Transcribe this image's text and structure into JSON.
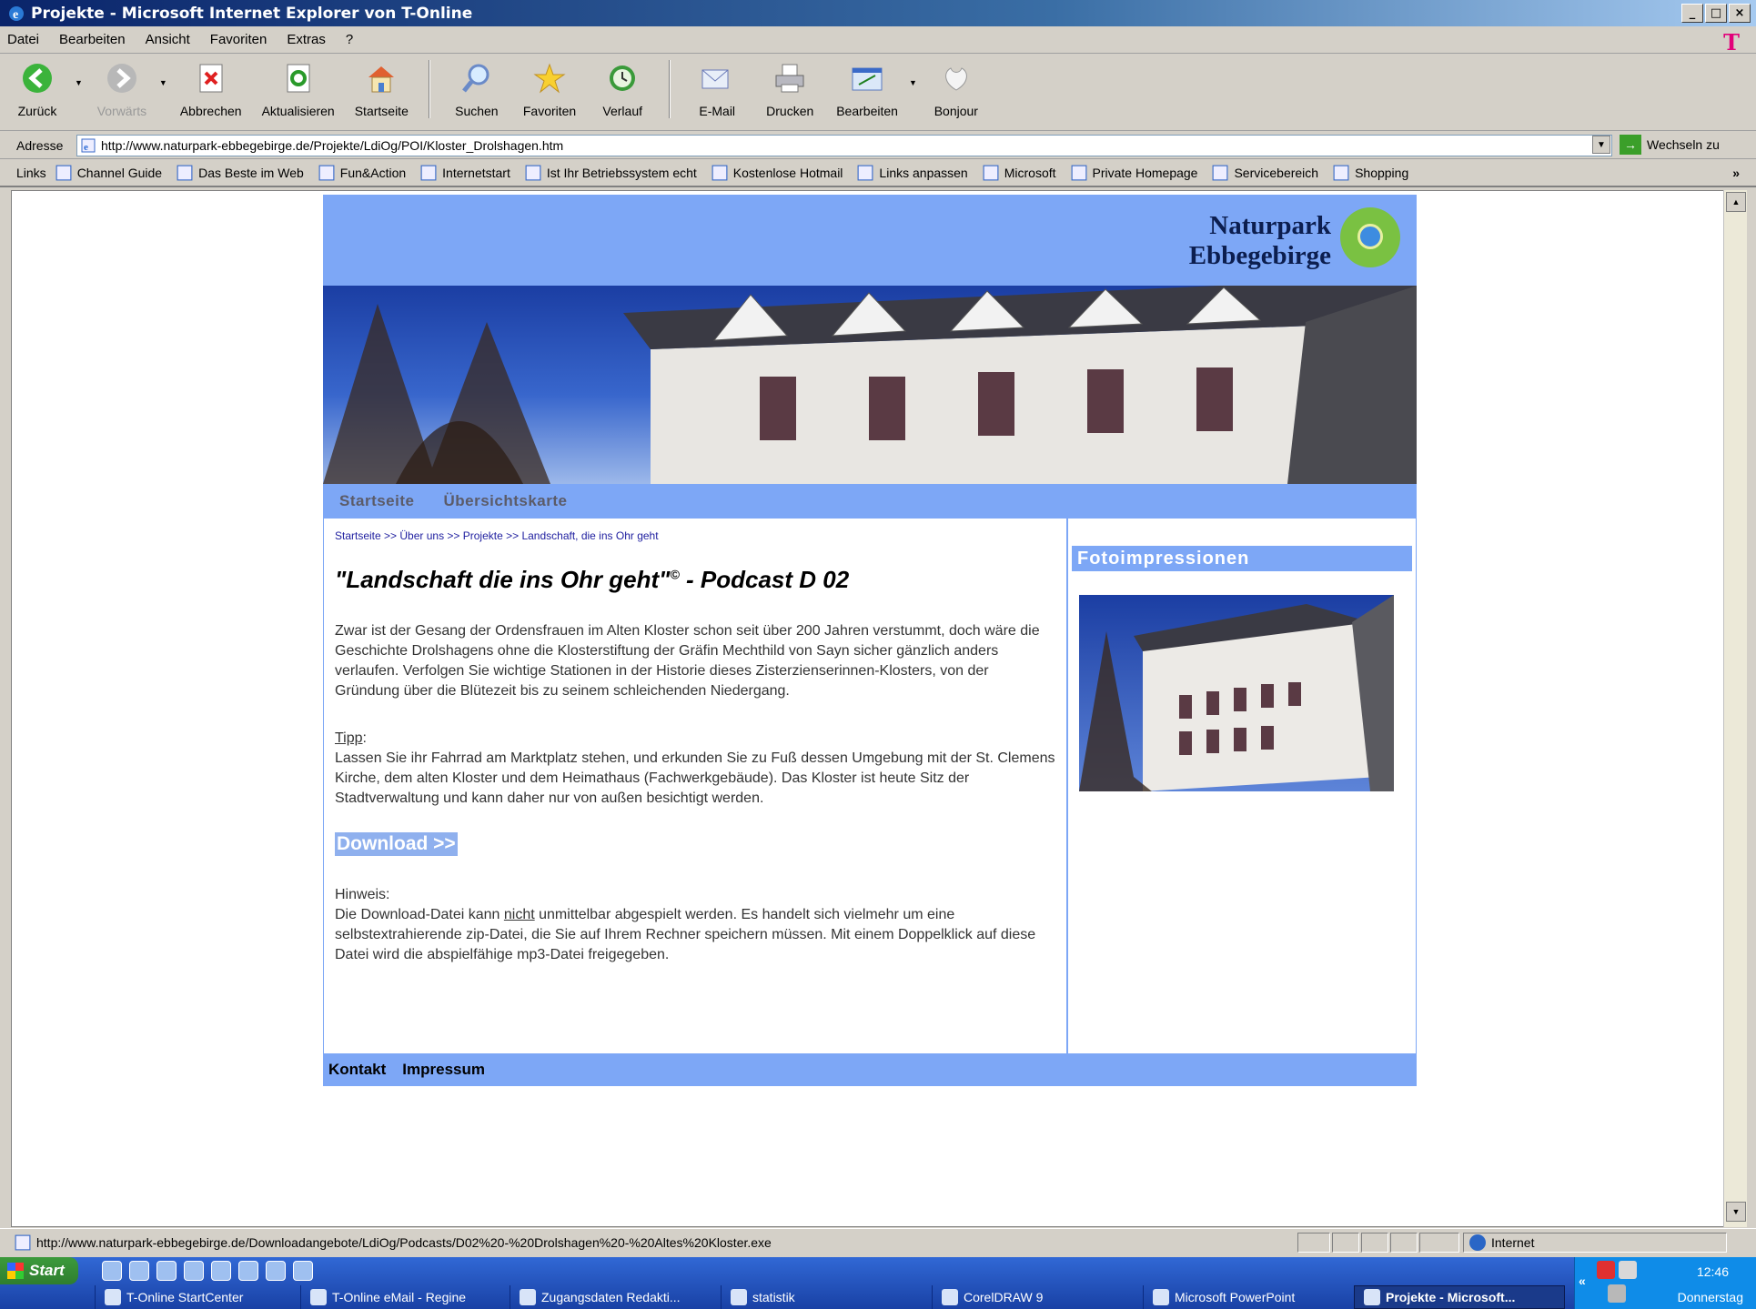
{
  "window": {
    "title": "Projekte - Microsoft Internet Explorer von T-Online",
    "min": "_",
    "max": "□",
    "close": "×"
  },
  "menu": {
    "items": [
      "Datei",
      "Bearbeiten",
      "Ansicht",
      "Favoriten",
      "Extras",
      "?"
    ],
    "logo": "T"
  },
  "toolbar": {
    "back": "Zurück",
    "forward": "Vorwärts",
    "stop": "Abbrechen",
    "refresh": "Aktualisieren",
    "home": "Startseite",
    "search": "Suchen",
    "favorites": "Favoriten",
    "history": "Verlauf",
    "mail": "E-Mail",
    "print": "Drucken",
    "edit": "Bearbeiten",
    "bonjour": "Bonjour"
  },
  "address": {
    "label": "Adresse",
    "url": "http://www.naturpark-ebbegebirge.de/Projekte/LdiOg/POI/Kloster_Drolshagen.htm",
    "go": "Wechseln zu"
  },
  "links": {
    "label": "Links",
    "items": [
      "Channel Guide",
      "Das Beste im Web",
      "Fun&Action",
      "Internetstart",
      "Ist Ihr Betriebssystem echt",
      "Kostenlose Hotmail",
      "Links anpassen",
      "Microsoft",
      "Private Homepage",
      "Servicebereich",
      "Shopping"
    ],
    "more": "»"
  },
  "site": {
    "brand_line1": "Naturpark",
    "brand_line2": "Ebbegebirge",
    "nav": [
      "Startseite",
      "Übersichtskarte"
    ],
    "breadcrumb": "Startseite >> Über uns >> Projekte >> Landschaft, die ins Ohr geht",
    "title": "\"Landschaft die ins Ohr geht\"",
    "title_sup": "©",
    "title_suffix": " -  Podcast D 02",
    "p1": "Zwar ist der Gesang der Ordensfrauen im Alten Kloster schon seit über 200 Jahren verstummt, doch wäre die Geschichte Drolshagens ohne die Klosterstiftung der Gräfin Mechthild von Sayn sicher gänzlich anders verlaufen. Verfolgen Sie wichtige Stationen in der Historie dieses Zisterzienserinnen-Klosters, von der Gründung über die Blütezeit bis zu seinem schleichenden Niedergang.",
    "tipp_label": "Tipp",
    "tipp_colon": ":",
    "tipp_text": "Lassen Sie ihr Fahrrad am Marktplatz stehen, und erkunden Sie zu Fuß dessen Umgebung mit der St. Clemens Kirche, dem alten Kloster und dem Heimathaus (Fachwerkgebäude). Das Kloster ist heute Sitz der Stadtverwaltung und kann daher nur von außen besichtigt werden.",
    "download": "Download >>",
    "hinweis_label": "Hinweis:",
    "hinweis_a": "Die Download-Datei kann ",
    "hinweis_u": "nicht",
    "hinweis_b": " unmittelbar abgespielt werden. Es handelt sich vielmehr um eine selbstextrahierende zip-Datei, die Sie auf Ihrem Rechner speichern müssen. Mit einem Doppelklick auf diese Datei wird die abspielfähige mp3-Datei freigegeben.",
    "sidebar_title": "Fotoimpressionen",
    "footer": [
      "Kontakt",
      "Impressum"
    ]
  },
  "status": {
    "url": "http://www.naturpark-ebbegebirge.de/Downloadangebote/LdiOg/Podcasts/D02%20-%20Drolshagen%20-%20Altes%20Kloster.exe",
    "zone": "Internet"
  },
  "taskbar": {
    "start": "Start",
    "tasks": [
      "T-Online StartCenter",
      "T-Online eMail - Regine",
      "Zugangsdaten Redakti...",
      "statistik",
      "CorelDRAW 9",
      "Microsoft PowerPoint",
      "Projekte - Microsoft..."
    ],
    "clock": "12:46",
    "day": "Donnerstag",
    "chevron": "«"
  },
  "colors": {
    "site_blue": "#7da7f6",
    "title_bar": "#0a246a",
    "taskbar": "#3168d5"
  }
}
